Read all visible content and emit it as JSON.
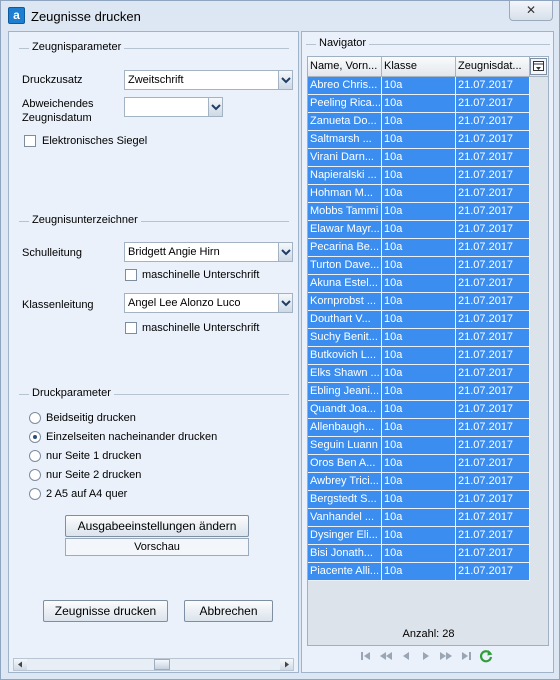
{
  "window": {
    "title": "Zeugnisse drucken",
    "close_label": "✕"
  },
  "params": {
    "legend": "Zeugnisparameter",
    "druckzusatz_label": "Druckzusatz",
    "druckzusatz_value": "Zweitschrift",
    "datum_label_1": "Abweichendes",
    "datum_label_2": "Zeugnisdatum",
    "datum_value": "",
    "siegel_label": "Elektronisches Siegel"
  },
  "signer": {
    "legend": "Zeugnisunterzeichner",
    "schulleitung_label": "Schulleitung",
    "schulleitung_value": "Bridgett Angie Hirn",
    "klassenleitung_label": "Klassenleitung",
    "klassenleitung_value": "Angel Lee Alonzo Luco",
    "maschinell_label": "maschinelle Unterschrift"
  },
  "print": {
    "legend": "Druckparameter",
    "options": [
      "Beidseitig drucken",
      "Einzelseiten nacheinander drucken",
      "nur Seite 1 drucken",
      "nur Seite 2 drucken",
      "2 A5 auf A4 quer"
    ],
    "selected_index": 1,
    "settings_button": "Ausgabeeinstellungen ändern",
    "preview_button": "Vorschau",
    "print_button": "Zeugnisse drucken",
    "cancel_button": "Abbrechen"
  },
  "navigator": {
    "legend": "Navigator",
    "columns": [
      "Name, Vorn...",
      "Klasse",
      "Zeugnisdat..."
    ],
    "rows": [
      [
        "Abreo Chris...",
        "10a",
        "21.07.2017"
      ],
      [
        "Peeling Rica...",
        "10a",
        "21.07.2017"
      ],
      [
        "Zanueta Do...",
        "10a",
        "21.07.2017"
      ],
      [
        "Saltmarsh ...",
        "10a",
        "21.07.2017"
      ],
      [
        "Virani Darn...",
        "10a",
        "21.07.2017"
      ],
      [
        "Napieralski ...",
        "10a",
        "21.07.2017"
      ],
      [
        "Hohman M...",
        "10a",
        "21.07.2017"
      ],
      [
        "Mobbs Tammi",
        "10a",
        "21.07.2017"
      ],
      [
        "Elawar Mayr...",
        "10a",
        "21.07.2017"
      ],
      [
        "Pecarina Be...",
        "10a",
        "21.07.2017"
      ],
      [
        "Turton Dave...",
        "10a",
        "21.07.2017"
      ],
      [
        "Akuna Estel...",
        "10a",
        "21.07.2017"
      ],
      [
        "Kornprobst ...",
        "10a",
        "21.07.2017"
      ],
      [
        "Douthart V...",
        "10a",
        "21.07.2017"
      ],
      [
        "Suchy Benit...",
        "10a",
        "21.07.2017"
      ],
      [
        "Butkovich L...",
        "10a",
        "21.07.2017"
      ],
      [
        "Elks Shawn ...",
        "10a",
        "21.07.2017"
      ],
      [
        "Ebling Jeani...",
        "10a",
        "21.07.2017"
      ],
      [
        "Quandt Joa...",
        "10a",
        "21.07.2017"
      ],
      [
        "Allenbaugh...",
        "10a",
        "21.07.2017"
      ],
      [
        "Seguin Luann",
        "10a",
        "21.07.2017"
      ],
      [
        "Oros Ben A...",
        "10a",
        "21.07.2017"
      ],
      [
        "Awbrey Trici...",
        "10a",
        "21.07.2017"
      ],
      [
        "Bergstedt S...",
        "10a",
        "21.07.2017"
      ],
      [
        "Vanhandel ...",
        "10a",
        "21.07.2017"
      ],
      [
        "Dysinger Eli...",
        "10a",
        "21.07.2017"
      ],
      [
        "Bisi Jonath...",
        "10a",
        "21.07.2017"
      ],
      [
        "Piacente Alli...",
        "10a",
        "21.07.2017"
      ]
    ],
    "count_label": "Anzahl: 28"
  },
  "colors": {
    "selection": "#3b8ef0",
    "refresh": "#2f9e3a"
  }
}
